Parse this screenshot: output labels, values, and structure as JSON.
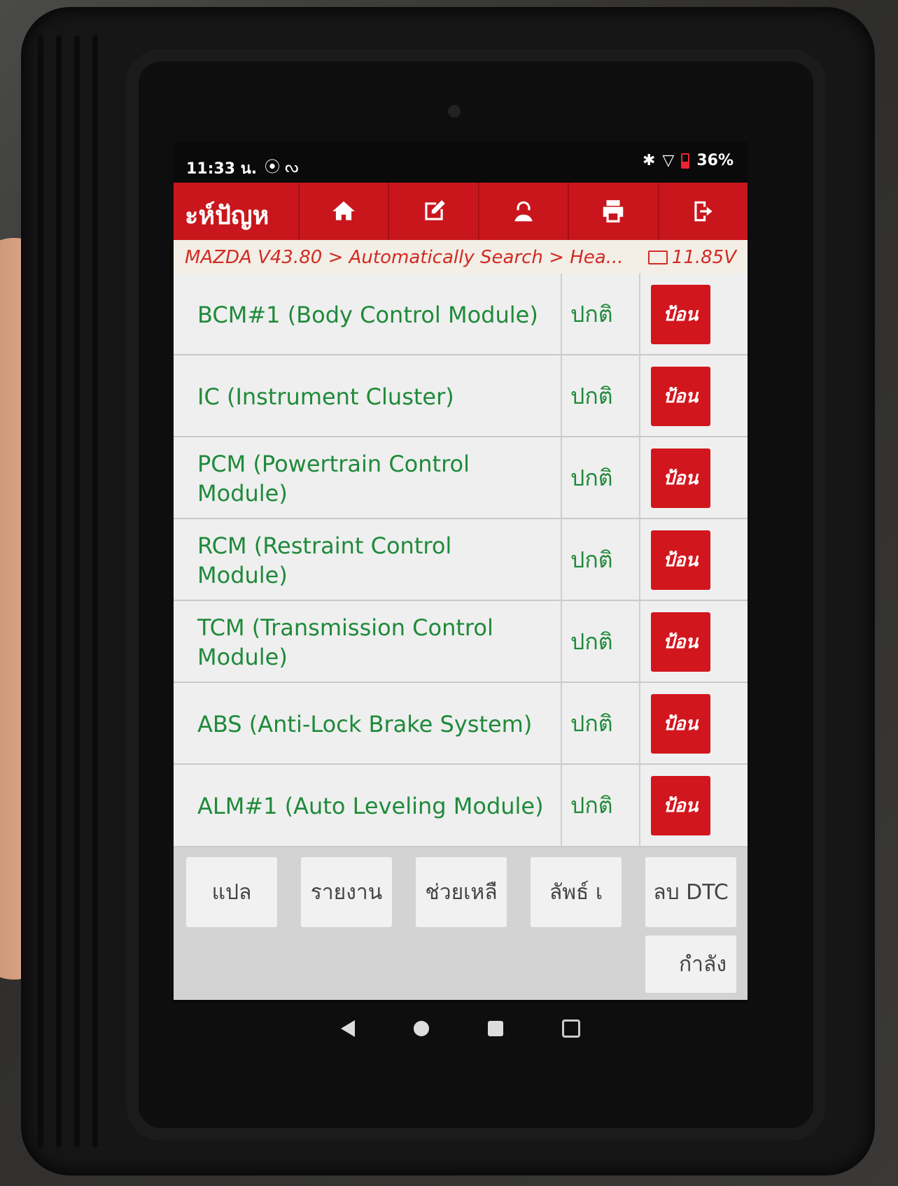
{
  "status_bar": {
    "time": "11:33 น.",
    "battery": "36%"
  },
  "top_bar": {
    "title": "ะห์ปัญห"
  },
  "breadcrumb": {
    "path": "MAZDA V43.80 > Automatically Search > Hea...",
    "voltage": "11.85V"
  },
  "modules": [
    {
      "name": "BCM#1 (Body Control Module)",
      "status": "ปกติ",
      "action": "ป้อน"
    },
    {
      "name": "IC (Instrument Cluster)",
      "status": "ปกติ",
      "action": "ป้อน"
    },
    {
      "name": "PCM (Powertrain Control Module)",
      "status": "ปกติ",
      "action": "ป้อน"
    },
    {
      "name": "RCM (Restraint Control Module)",
      "status": "ปกติ",
      "action": "ป้อน"
    },
    {
      "name": "TCM (Transmission Control Module)",
      "status": "ปกติ",
      "action": "ป้อน"
    },
    {
      "name": "ABS (Anti-Lock Brake System)",
      "status": "ปกติ",
      "action": "ป้อน"
    },
    {
      "name": "ALM#1 (Auto Leveling Module)",
      "status": "ปกติ",
      "action": "ป้อน"
    }
  ],
  "function_buttons": {
    "translate": "แปล",
    "report": "รายงาน",
    "help": "ช่วยเหลื",
    "terms": "ลัพธ์  เ",
    "clear_dtc": "ลบ DTC",
    "loading": "กำลัง"
  },
  "icons": {
    "home": "home-icon",
    "edit": "edit-icon",
    "support": "support-icon",
    "print": "print-icon",
    "exit": "exit-icon"
  },
  "colors": {
    "accent_red": "#c8161c",
    "module_green": "#1f8a3a"
  }
}
